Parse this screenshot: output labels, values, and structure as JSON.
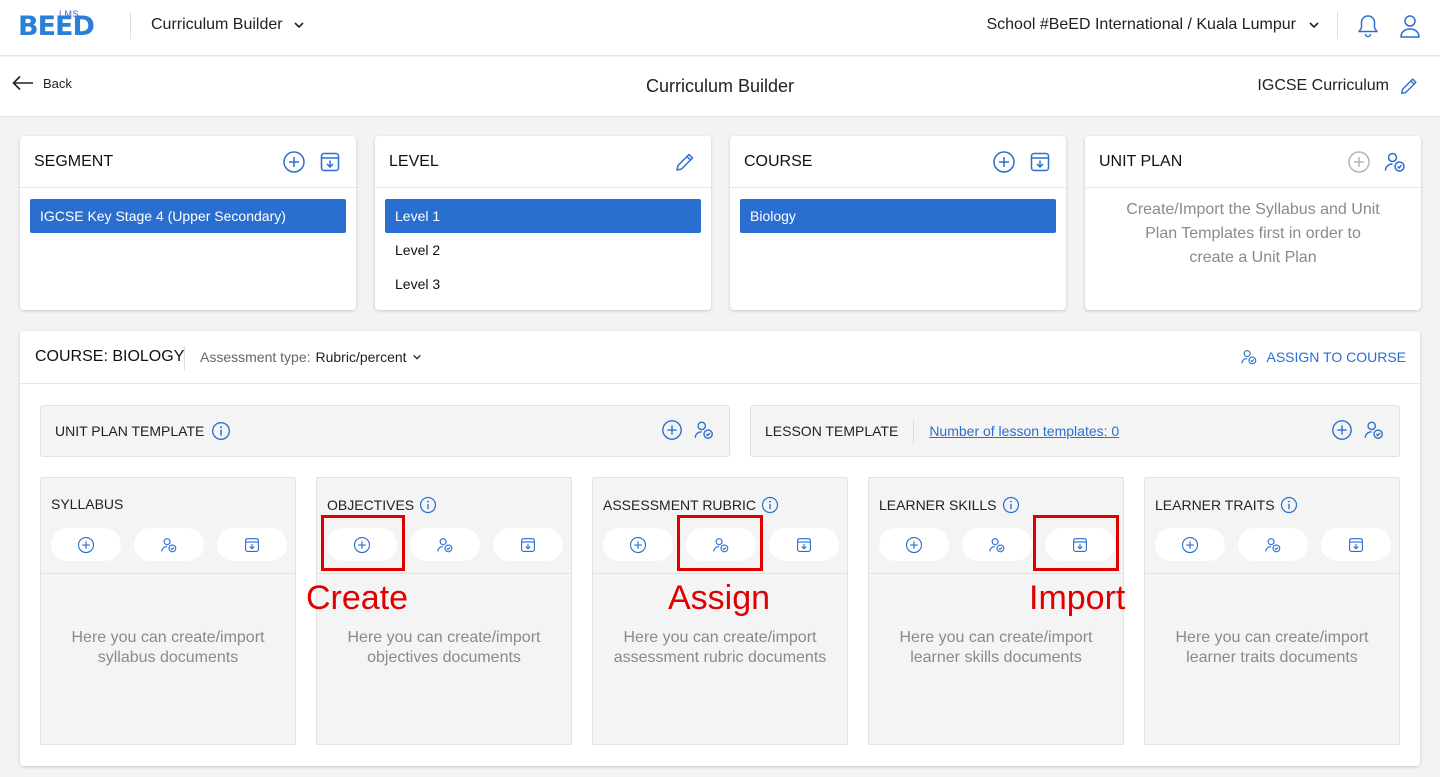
{
  "topbar": {
    "logo_small": "LMS",
    "logo_text": "BEED",
    "app_switcher": "Curriculum Builder",
    "school": "School #BeED International / Kuala Lumpur",
    "brand_color": "#2a6fcf"
  },
  "subheader": {
    "back_label": "Back",
    "title": "Curriculum Builder",
    "curriculum": "IGCSE Curriculum"
  },
  "cards": {
    "segment": {
      "title": "SEGMENT",
      "items": [
        "IGCSE Key Stage 4 (Upper Secondary)"
      ],
      "selected": 0
    },
    "level": {
      "title": "LEVEL",
      "items": [
        "Level 1",
        "Level 2",
        "Level 3"
      ],
      "selected": 0
    },
    "course": {
      "title": "COURSE",
      "items": [
        "Biology"
      ],
      "selected": 0
    },
    "unit_plan": {
      "title": "UNIT PLAN",
      "message": "Create/Import the Syllabus and Unit Plan Templates first in order to create a Unit Plan"
    }
  },
  "course_panel": {
    "title": "COURSE: BIOLOGY",
    "assessment_label": "Assessment type:",
    "assessment_value": "Rubric/percent",
    "assign_to_course": "ASSIGN TO COURSE",
    "unit_plan_template": "UNIT PLAN TEMPLATE",
    "lesson_template": "LESSON TEMPLATE",
    "lesson_template_link": "Number of lesson templates: 0",
    "columns": [
      {
        "title": "SYLLABUS",
        "info": false,
        "empty": "Here you can create/import syllabus documents"
      },
      {
        "title": "OBJECTIVES",
        "info": true,
        "empty": "Here you can create/import objectives documents"
      },
      {
        "title": "ASSESSMENT RUBRIC",
        "info": true,
        "empty": "Here you can create/import assessment rubric documents"
      },
      {
        "title": "LEARNER SKILLS",
        "info": true,
        "empty": "Here you can create/import learner skills documents"
      },
      {
        "title": "LEARNER TRAITS",
        "info": true,
        "empty": "Here you can create/import learner traits documents"
      }
    ]
  },
  "annotations": {
    "create": "Create",
    "assign": "Assign",
    "import": "Import",
    "color": "#e00000"
  }
}
